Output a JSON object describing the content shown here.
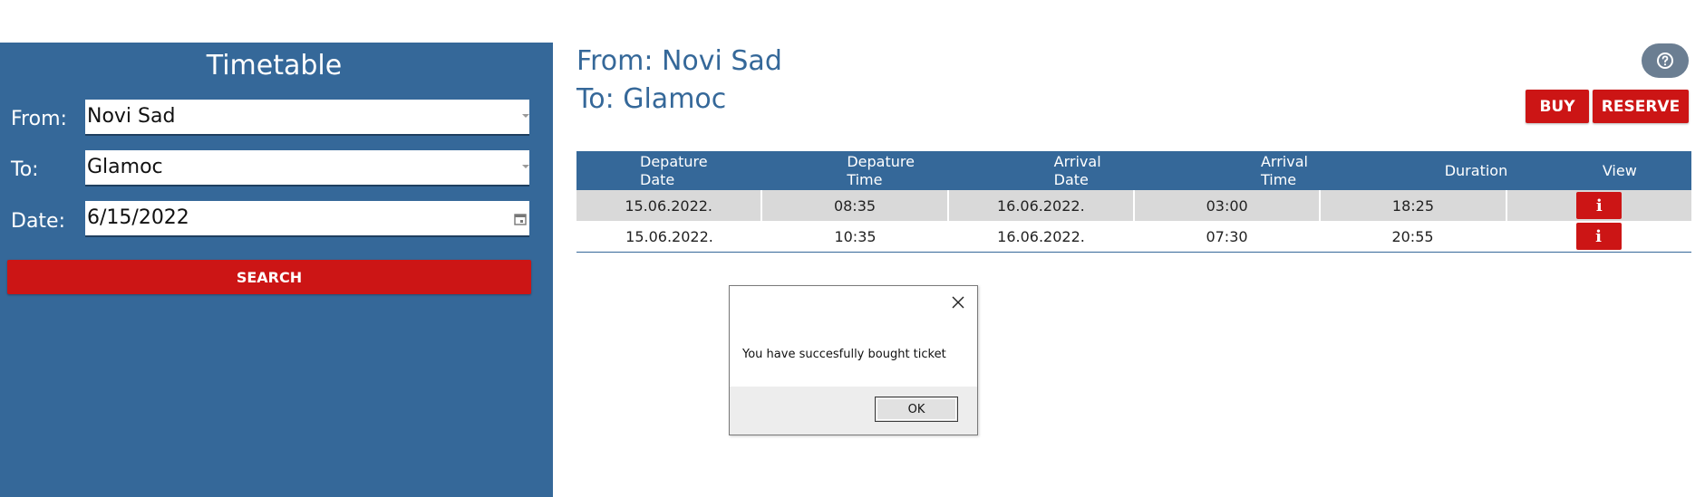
{
  "search_panel": {
    "title": "Timetable",
    "from_label": "From:",
    "from_value": "Novi Sad",
    "to_label": "To:",
    "to_value": "Glamoc",
    "date_label": "Date:",
    "date_value": "6/15/2022",
    "search_label": "SEARCH"
  },
  "route": {
    "from_text": "From: Novi Sad",
    "to_text": "To: Glamoc"
  },
  "actions": {
    "help_icon": "question-circle-icon",
    "buy_label": "BUY",
    "reserve_label": "RESERVE"
  },
  "table": {
    "headers": [
      {
        "line1": "Depature",
        "line2": "Date"
      },
      {
        "line1": "Depature",
        "line2": "Time"
      },
      {
        "line1": "Arrival",
        "line2": "Date"
      },
      {
        "line1": "Arrival",
        "line2": "Time"
      },
      {
        "line1": "Duration",
        "line2": ""
      },
      {
        "line1": "View",
        "line2": ""
      }
    ],
    "rows": [
      {
        "dep_date": "15.06.2022.",
        "dep_time": "08:35",
        "arr_date": "16.06.2022.",
        "arr_time": "03:00",
        "duration": "18:25",
        "view_icon": "i"
      },
      {
        "dep_date": "15.06.2022.",
        "dep_time": "10:35",
        "arr_date": "16.06.2022.",
        "arr_time": "07:30",
        "duration": "20:55",
        "view_icon": "i"
      }
    ]
  },
  "dialog": {
    "message": "You have succesfully bought ticket",
    "ok_label": "OK"
  },
  "colors": {
    "panel_blue": "#356899",
    "accent_red": "#cc1515",
    "help_grey": "#6b7e92"
  }
}
